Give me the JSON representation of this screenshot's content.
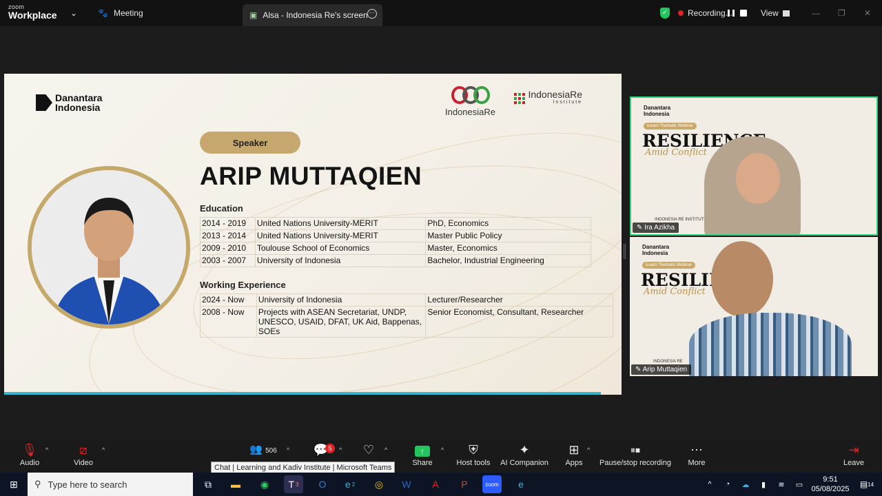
{
  "titlebar": {
    "logo_small": "zoom",
    "logo_big": "Workplace",
    "meeting_label": "Meeting",
    "share_tab_label": "Alsa - Indonesia Re's screen",
    "recording_label": "Recording...",
    "view_label": "View"
  },
  "slide": {
    "danantara_logo": "Danantara Indonesia",
    "indonesiare_logo": "IndonesiaRe",
    "institute_logo": "IndonesiaRe",
    "institute_sub": "Institute",
    "speaker_pill": "Speaker",
    "speaker_name": "ARIP MUTTAQIEN",
    "education_heading": "Education",
    "education": [
      {
        "years": "2014 - 2019",
        "institution": "United Nations University-MERIT",
        "degree": "PhD, Economics"
      },
      {
        "years": "2013 - 2014",
        "institution": "United Nations University-MERIT",
        "degree": "Master Public Policy"
      },
      {
        "years": "2009 - 2010",
        "institution": "Toulouse School of Economics",
        "degree": "Master, Economics"
      },
      {
        "years": "2003 - 2007",
        "institution": "University of Indonesia",
        "degree": "Bachelor, Industrial Engineering"
      }
    ],
    "work_heading": "Working Experience",
    "work": [
      {
        "years": "2024 - Now",
        "org": "University of Indonesia",
        "role": "Lecturer/Researcher"
      },
      {
        "years": "2008 - Now",
        "org": "Projects with ASEAN Secretariat, UNDP, UNESCO, USAID, DFAT, UK Aid, Bappenas, SOEs",
        "role": "Senior Economist, Consultant, Researcher"
      }
    ]
  },
  "participants": [
    {
      "name": "Ira Azikha",
      "tile_logo": "Danantara Indonesia",
      "tag": "iLearn Thematic Webinar",
      "title": "RESILIENCE",
      "subtitle": "Amid Conflict",
      "footer": "INDONESIA RE INSTITUTE"
    },
    {
      "name": "Arip Muttaqien",
      "tile_logo": "Danantara Indonesia",
      "tag": "iLearn Thematic Webinar",
      "title": "RESILIE",
      "subtitle": "Amid Conflict",
      "footer": "INDONESIA RE"
    }
  ],
  "toolbar": {
    "audio": "Audio",
    "video": "Video",
    "participants_count": "506",
    "chat_badge": "5",
    "share": "Share",
    "host_tools": "Host tools",
    "ai_companion": "AI Companion",
    "apps": "Apps",
    "pause_stop": "Pause/stop recording",
    "more": "More",
    "leave": "Leave",
    "tooltip": "Chat | Learning and Kadiv Institute | Microsoft Teams",
    "truncated_label": "t"
  },
  "taskbar": {
    "search_placeholder": "Type here to search",
    "time": "9:51",
    "date": "05/08/2025",
    "notif_count": "14",
    "teams_badge": "3",
    "edge_badge": "2"
  },
  "colors": {
    "accent_gold": "#c6a86f",
    "active_green": "#2fd07a",
    "record_red": "#e02424",
    "share_green": "#22c55e"
  }
}
